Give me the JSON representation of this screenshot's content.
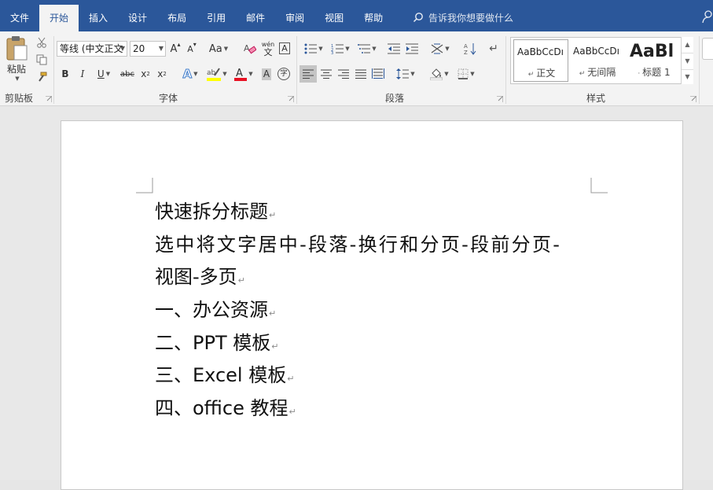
{
  "tabs": [
    "文件",
    "开始",
    "插入",
    "设计",
    "布局",
    "引用",
    "邮件",
    "审阅",
    "视图",
    "帮助"
  ],
  "active_tab": "开始",
  "tell_me": "告诉我你想要做什么",
  "clipboard": {
    "paste_label": "粘贴",
    "group_label": "剪贴板"
  },
  "font": {
    "font_name": "等线 (中文正文",
    "font_size": "20",
    "change_case": "Aa",
    "phonetic_glyph": "wén",
    "group_label": "字体"
  },
  "paragraph": {
    "group_label": "段落"
  },
  "styles": {
    "group_label": "样式",
    "items": [
      {
        "sample": "AaBbCcDı",
        "name": "正文"
      },
      {
        "sample": "AaBbCcDı",
        "name": "无间隔"
      },
      {
        "sample": "AaBl",
        "name": "标题 1"
      }
    ]
  },
  "colors": {
    "titlebar": "#2b579a",
    "ribbon": "#f3f3f3",
    "highlight": "#ffff00",
    "font_color": "#e81123"
  },
  "document": {
    "lines": [
      "快速拆分标题",
      "选中将文字居中-段落-换行和分页-段前分页-",
      "视图-多页",
      "一、办公资源",
      "二、PPT 模板",
      "三、Excel 模板",
      "四、office 教程"
    ],
    "paragraph_mark": "↵"
  }
}
